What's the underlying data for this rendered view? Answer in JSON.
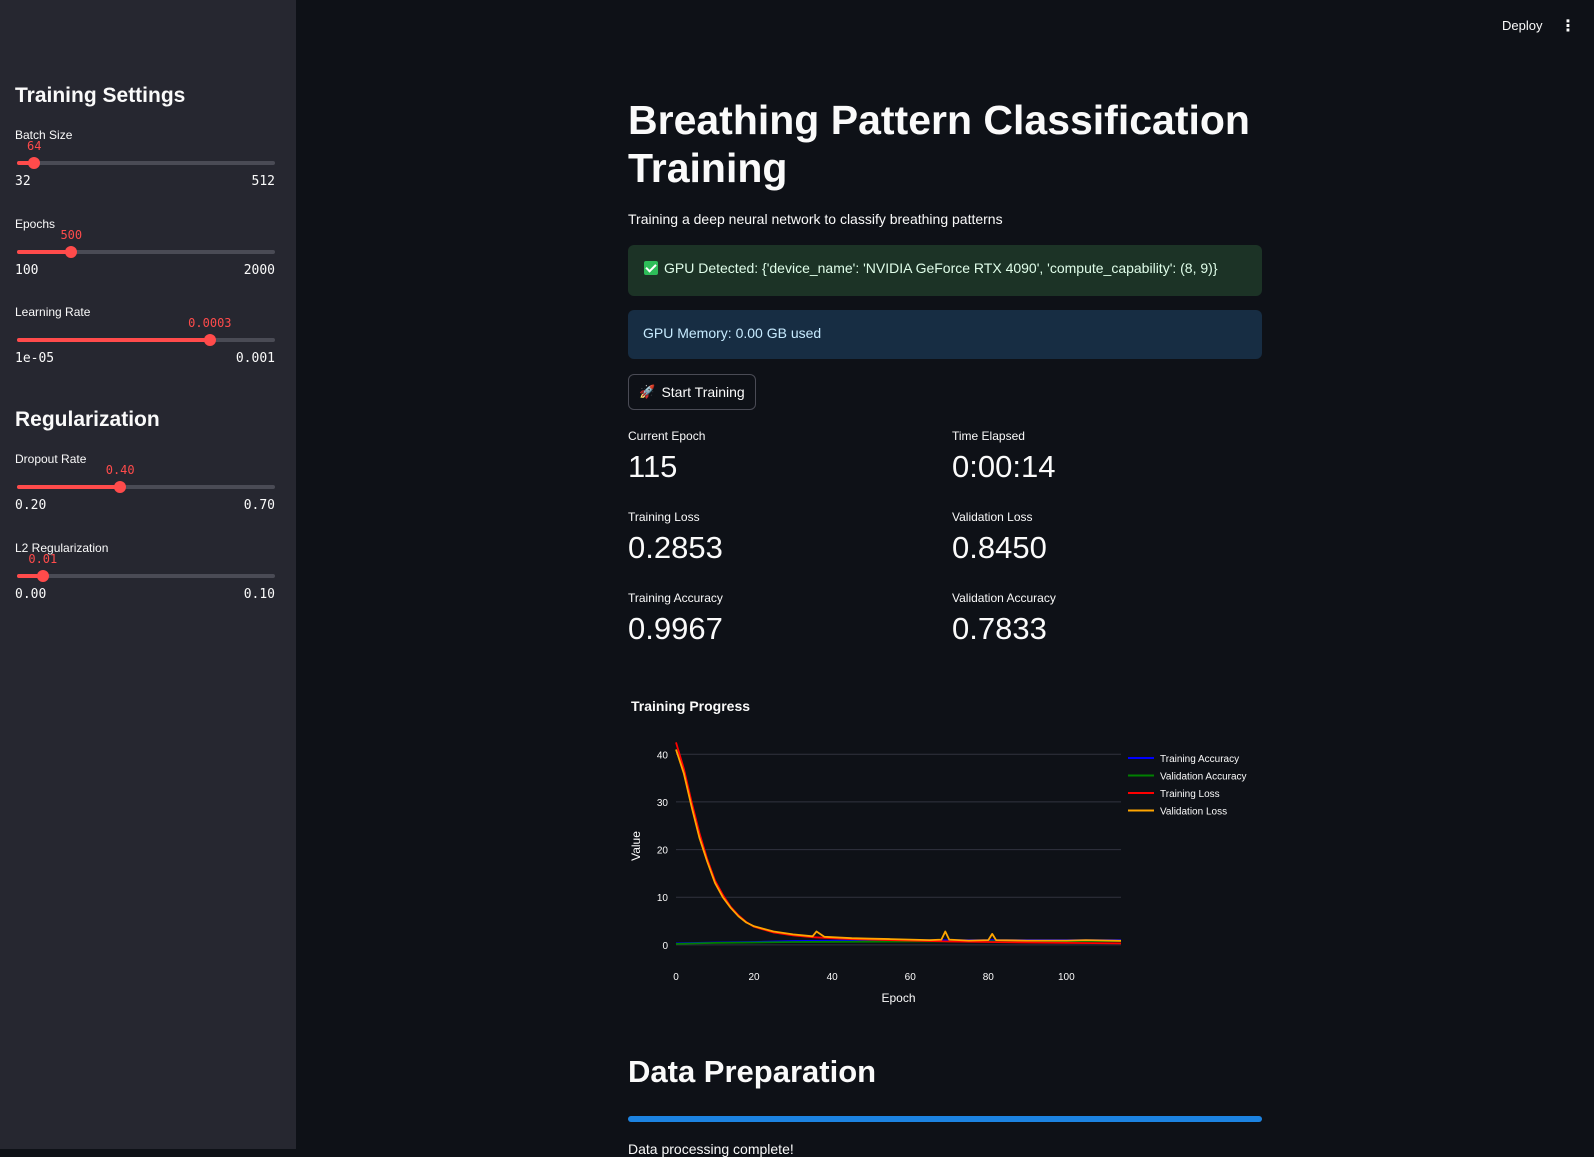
{
  "topbar": {
    "deploy_label": "Deploy",
    "menu_icon": "more-vertical-icon"
  },
  "sidebar": {
    "training_heading": "Training Settings",
    "regularization_heading": "Regularization",
    "sliders": {
      "batch_size": {
        "label": "Batch Size",
        "value": "64",
        "min": "32",
        "max": "512",
        "fraction": 0.0667
      },
      "epochs": {
        "label": "Epochs",
        "value": "500",
        "min": "100",
        "max": "2000",
        "fraction": 0.2105
      },
      "learning_rate": {
        "label": "Learning Rate",
        "value": "0.0003",
        "min": "1e-05",
        "max": "0.001",
        "fraction": 0.7475
      },
      "dropout": {
        "label": "Dropout Rate",
        "value": "0.40",
        "min": "0.20",
        "max": "0.70",
        "fraction": 0.4
      },
      "l2": {
        "label": "L2 Regularization",
        "value": "0.01",
        "min": "0.00",
        "max": "0.10",
        "fraction": 0.1
      }
    }
  },
  "main": {
    "title": "Breathing Pattern Classification Training",
    "subtitle": "Training a deep neural network to classify breathing patterns",
    "gpu_detected": "GPU Detected: {'device_name': 'NVIDIA GeForce RTX 4090', 'compute_capability': (8, 9)}",
    "gpu_memory": "GPU Memory: 0.00 GB used",
    "start_button": "Start Training",
    "metrics": {
      "current_epoch": {
        "label": "Current Epoch",
        "value": "115"
      },
      "time_elapsed": {
        "label": "Time Elapsed",
        "value": "0:00:14"
      },
      "training_loss": {
        "label": "Training Loss",
        "value": "0.2853"
      },
      "validation_loss": {
        "label": "Validation Loss",
        "value": "0.8450"
      },
      "training_accuracy": {
        "label": "Training Accuracy",
        "value": "0.9967"
      },
      "validation_accuracy": {
        "label": "Validation Accuracy",
        "value": "0.7833"
      }
    },
    "chart_heading": "Training Progress",
    "data_prep_heading": "Data Preparation",
    "data_prep_progress": 1.0,
    "data_prep_status": "Data processing complete!"
  },
  "colors": {
    "accent": "#ff4b4b",
    "training_accuracy": "#0000ff",
    "validation_accuracy": "#008000",
    "training_loss": "#ff0000",
    "validation_loss": "#ffa500",
    "progress": "#1c83e1"
  },
  "chart_data": {
    "type": "line",
    "title": "Training Progress",
    "xlabel": "Epoch",
    "ylabel": "Value",
    "xlim": [
      0,
      114
    ],
    "ylim": [
      -1.5,
      43
    ],
    "x_ticks": [
      0,
      20,
      40,
      60,
      80,
      100
    ],
    "y_ticks": [
      0,
      10,
      20,
      30,
      40
    ],
    "grid": true,
    "legend_position": "top-right",
    "series": [
      {
        "name": "Training Accuracy",
        "color": "#0000ff",
        "points": [
          [
            0,
            0.3
          ],
          [
            10,
            0.5
          ],
          [
            20,
            0.6
          ],
          [
            30,
            0.8
          ],
          [
            40,
            0.9
          ],
          [
            60,
            0.95
          ],
          [
            80,
            0.98
          ],
          [
            114,
            1.0
          ]
        ]
      },
      {
        "name": "Validation Accuracy",
        "color": "#008000",
        "points": [
          [
            0,
            0.2
          ],
          [
            10,
            0.4
          ],
          [
            20,
            0.5
          ],
          [
            30,
            0.6
          ],
          [
            40,
            0.65
          ],
          [
            60,
            0.7
          ],
          [
            80,
            0.75
          ],
          [
            114,
            0.78
          ]
        ]
      },
      {
        "name": "Training Loss",
        "color": "#ff0000",
        "points": [
          [
            0,
            42.5
          ],
          [
            2,
            37
          ],
          [
            4,
            30
          ],
          [
            6,
            23.5
          ],
          [
            8,
            18
          ],
          [
            10,
            13.5
          ],
          [
            12,
            10.5
          ],
          [
            14,
            8
          ],
          [
            16,
            6.2
          ],
          [
            18,
            4.8
          ],
          [
            20,
            3.8
          ],
          [
            25,
            2.6
          ],
          [
            30,
            2
          ],
          [
            35,
            1.6
          ],
          [
            40,
            1.4
          ],
          [
            45,
            1.2
          ],
          [
            50,
            1.1
          ],
          [
            60,
            0.9
          ],
          [
            70,
            0.7
          ],
          [
            80,
            0.6
          ],
          [
            90,
            0.5
          ],
          [
            100,
            0.4
          ],
          [
            114,
            0.3
          ]
        ]
      },
      {
        "name": "Validation Loss",
        "color": "#ffa500",
        "points": [
          [
            0,
            41
          ],
          [
            2,
            36
          ],
          [
            4,
            29
          ],
          [
            6,
            22.5
          ],
          [
            8,
            17.5
          ],
          [
            10,
            13
          ],
          [
            12,
            10
          ],
          [
            14,
            7.8
          ],
          [
            16,
            6
          ],
          [
            18,
            4.7
          ],
          [
            20,
            3.9
          ],
          [
            25,
            2.8
          ],
          [
            30,
            2.2
          ],
          [
            35,
            1.8
          ],
          [
            36,
            2.8
          ],
          [
            38,
            1.7
          ],
          [
            40,
            1.6
          ],
          [
            45,
            1.4
          ],
          [
            50,
            1.3
          ],
          [
            55,
            1.2
          ],
          [
            60,
            1.1
          ],
          [
            65,
            1.0
          ],
          [
            68,
            1.1
          ],
          [
            69,
            2.8
          ],
          [
            70,
            1.1
          ],
          [
            75,
            0.9
          ],
          [
            80,
            1.0
          ],
          [
            81,
            2.3
          ],
          [
            82,
            1.0
          ],
          [
            90,
            0.9
          ],
          [
            100,
            0.9
          ],
          [
            105,
            1.0
          ],
          [
            114,
            0.85
          ]
        ]
      }
    ]
  }
}
